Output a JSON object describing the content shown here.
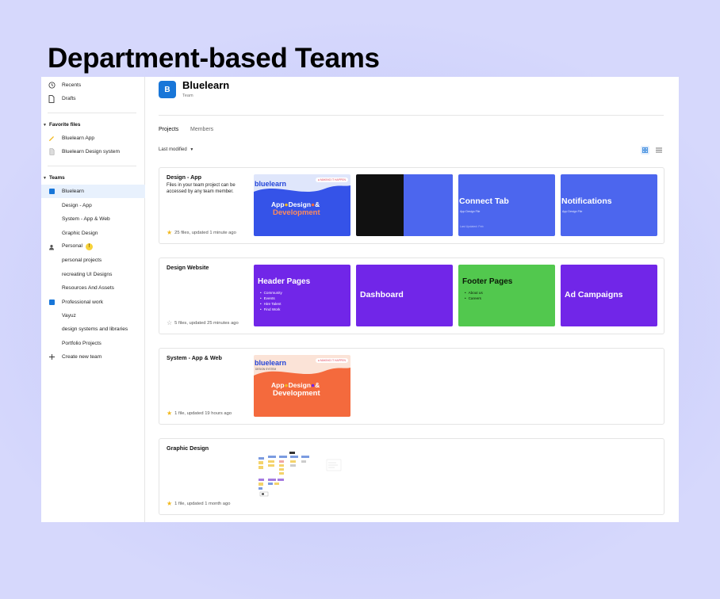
{
  "headline": "Department-based Teams",
  "sidebar": {
    "top_items": [
      {
        "label": "Recents",
        "icon": "clock-icon"
      },
      {
        "label": "Drafts",
        "icon": "file-icon"
      }
    ],
    "favorites_header": "Favorite files",
    "favorites": [
      {
        "label": "Bluelearn App",
        "icon": "pen-icon"
      },
      {
        "label": "Bluelearn Design system",
        "icon": "file-icon"
      }
    ],
    "teams_header": "Teams",
    "teams": [
      {
        "label": "Bluelearn",
        "icon": "team-square-icon",
        "active": true
      },
      {
        "label": "Design - App"
      },
      {
        "label": "System - App & Web"
      },
      {
        "label": "Graphic Design"
      },
      {
        "label": "Personal",
        "icon": "person-icon",
        "badge": "!"
      },
      {
        "label": "personal projects"
      },
      {
        "label": "recreating UI Designs"
      },
      {
        "label": "Resources And Assets"
      },
      {
        "label": "Professional work",
        "icon": "team-square-icon"
      },
      {
        "label": "Vayuz"
      },
      {
        "label": "design systems and libraries"
      },
      {
        "label": "Portfolio Projects"
      },
      {
        "label": "Create new team",
        "icon": "plus-icon"
      }
    ]
  },
  "header": {
    "logo_letter": "B",
    "team_name": "Bluelearn",
    "team_sub": "Team"
  },
  "tabs": [
    "Projects",
    "Members"
  ],
  "sort_label": "Last modified",
  "projects": [
    {
      "title": "Design - App",
      "description": "Files in your team project can be accessed by any team member.",
      "meta": "25 files, updated 1 minute ago",
      "starred": true,
      "thumbs": [
        {
          "kind": "app",
          "line1": "bluelearn",
          "tag": "MAKING IT HAPPEN",
          "line2": "App",
          "line3": "Design",
          "line4": "&",
          "line5": "Development"
        },
        {
          "kind": "split"
        },
        {
          "kind": "blue",
          "title": "Connect Tab",
          "small": "App Design File",
          "small2": "Last Updated: Feb"
        },
        {
          "kind": "blue",
          "title": "Notifications",
          "small": "App Design File"
        }
      ]
    },
    {
      "title": "Design Website",
      "description": "",
      "meta": "5 files, updated 25 minutes ago",
      "starred": false,
      "thumbs": [
        {
          "kind": "purple-list",
          "title": "Header Pages",
          "items": [
            "Community",
            "Events",
            "Hire Talent",
            "Find Work"
          ]
        },
        {
          "kind": "purple",
          "title": "Dashboard"
        },
        {
          "kind": "green-list",
          "title": "Footer Pages",
          "items": [
            "About us",
            "Careers"
          ]
        },
        {
          "kind": "purple",
          "title": "Ad Campaigns"
        }
      ]
    },
    {
      "title": "System - App & Web",
      "description": "",
      "meta": "1 file, updated 19 hours ago",
      "starred": true,
      "thumbs": [
        {
          "kind": "orange",
          "line1": "bluelearn",
          "sub": "DESIGN SYSTEM",
          "tag": "MAKING IT HAPPEN",
          "line2": "App",
          "line3": "Design",
          "line4": "&",
          "line5": "Development"
        }
      ]
    },
    {
      "title": "Graphic Design",
      "description": "",
      "meta": "1 file, updated 1 month ago",
      "starred": true,
      "thumbs": [
        {
          "kind": "sketch"
        }
      ]
    }
  ],
  "colors": {
    "accent": "#1876d8",
    "thumb_blue": "#4c66ee",
    "thumb_purple": "#7126e8",
    "thumb_green": "#52c84e",
    "thumb_orange": "#f46a3d"
  }
}
